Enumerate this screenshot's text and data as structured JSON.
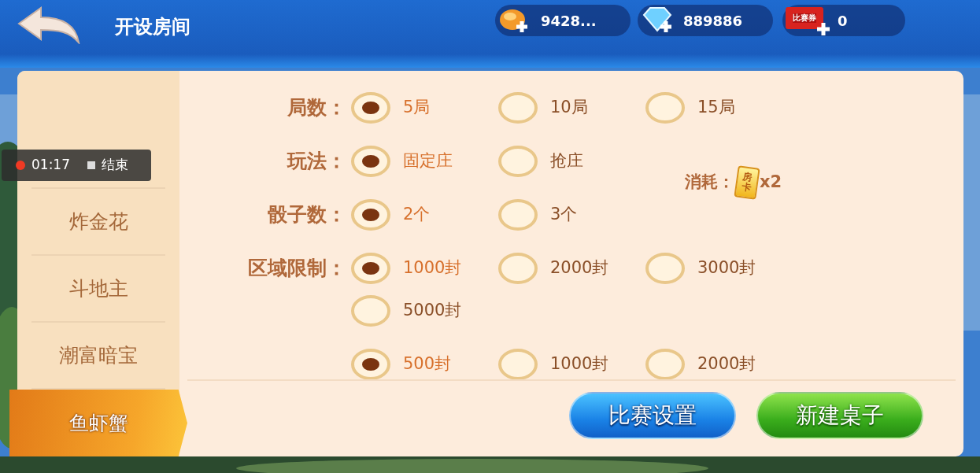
{
  "top_bar": {
    "title": "开设房间",
    "currencies": [
      {
        "kind": "gold",
        "value": "9428..."
      },
      {
        "kind": "diamond",
        "value": "889886"
      },
      {
        "kind": "ticket",
        "value": "0",
        "icon_text": "比赛券"
      }
    ]
  },
  "sidebar": {
    "items": [
      {
        "label": "炸金花",
        "selected": false
      },
      {
        "label": "斗地主",
        "selected": false
      },
      {
        "label": "潮富暗宝",
        "selected": false
      },
      {
        "label": "鱼虾蟹",
        "selected": true
      }
    ]
  },
  "options": [
    {
      "label": "局数：",
      "choices": [
        {
          "label": "5局",
          "selected": true
        },
        {
          "label": "10局",
          "selected": false
        },
        {
          "label": "15局",
          "selected": false
        }
      ]
    },
    {
      "label": "玩法：",
      "choices": [
        {
          "label": "固定庄",
          "selected": true
        },
        {
          "label": "抢庄",
          "selected": false
        }
      ]
    },
    {
      "label": "骰子数：",
      "choices": [
        {
          "label": "2个",
          "selected": true
        },
        {
          "label": "3个",
          "selected": false
        }
      ]
    },
    {
      "label": "区域限制：",
      "choices": [
        {
          "label": "1000封",
          "selected": true
        },
        {
          "label": "2000封",
          "selected": false
        },
        {
          "label": "3000封",
          "selected": false
        },
        {
          "label": "5000封",
          "selected": false
        }
      ]
    },
    {
      "choices": [
        {
          "label": "500封",
          "selected": true
        },
        {
          "label": "1000封",
          "selected": false
        },
        {
          "label": "2000封",
          "selected": false
        }
      ]
    }
  ],
  "cost": {
    "label": "消耗：",
    "card_text": "房卡",
    "amount": "x2"
  },
  "buttons": [
    {
      "label": "比赛设置",
      "kind": "blue"
    },
    {
      "label": "新建桌子",
      "kind": "green"
    }
  ],
  "recording": {
    "time": "01:17",
    "stop_label": "结束"
  }
}
